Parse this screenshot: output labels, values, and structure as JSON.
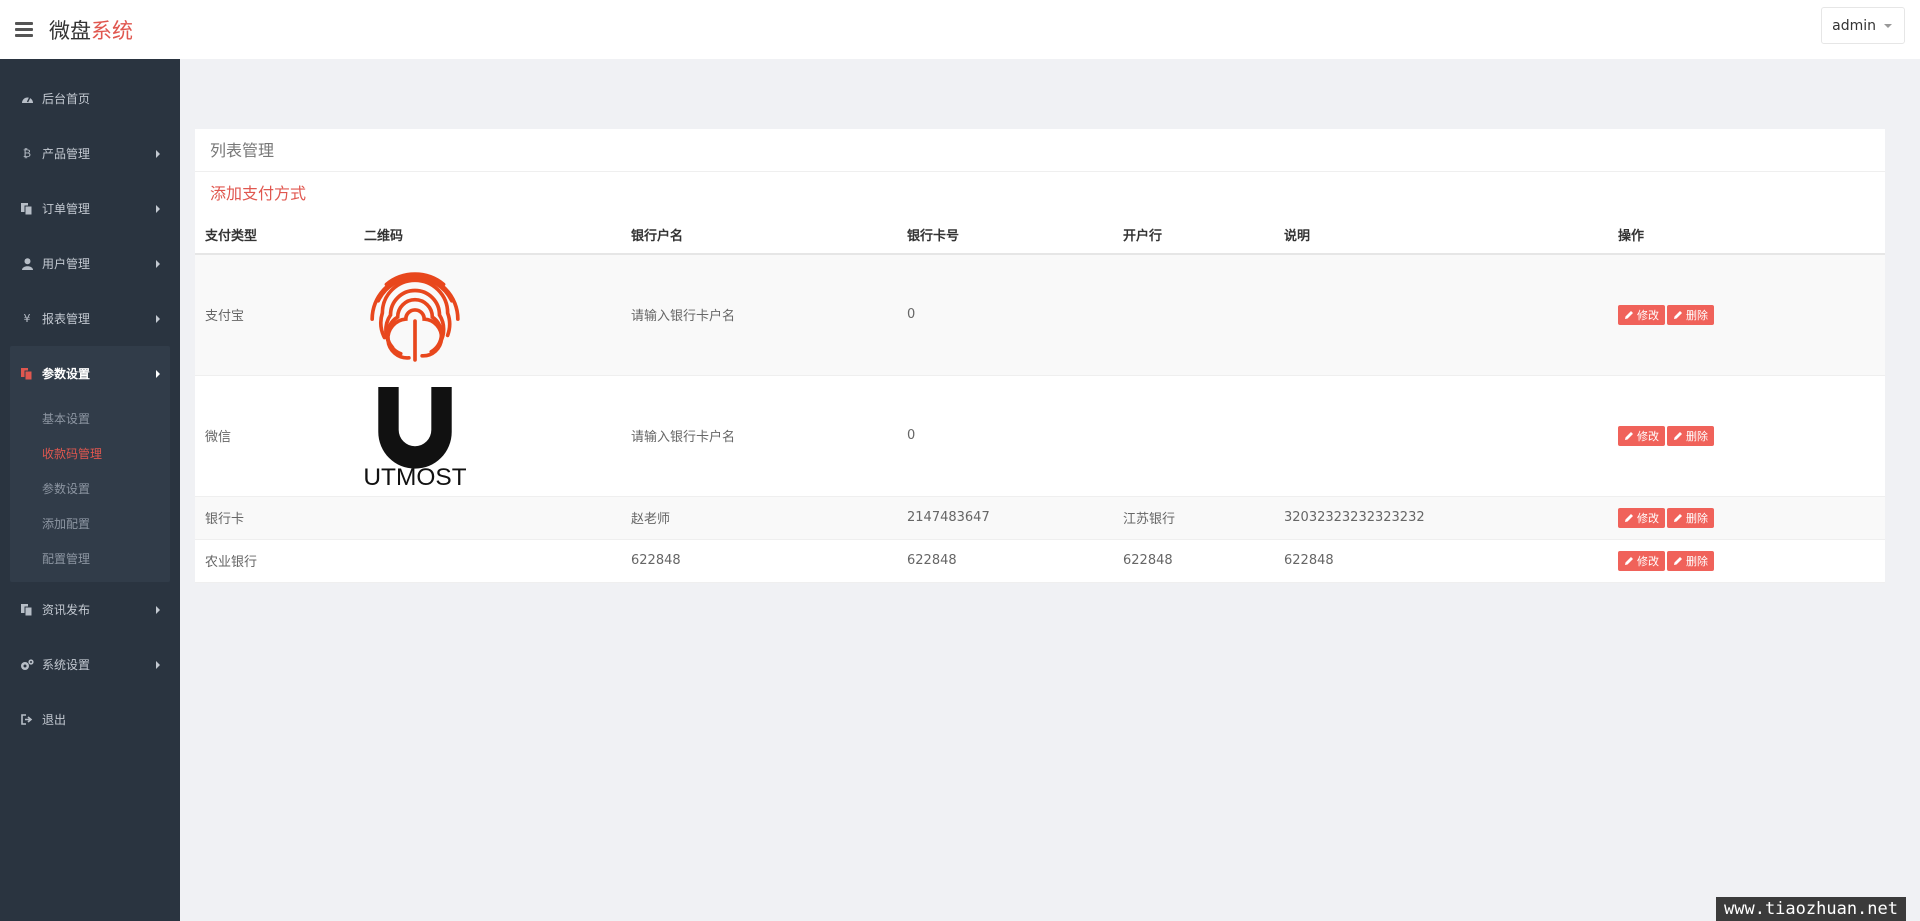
{
  "header": {
    "brand_prefix": "微盘",
    "brand_suffix": "系统",
    "user": "admin",
    "accent_color": "#e0574f"
  },
  "sidebar": {
    "items": [
      {
        "label": "后台首页",
        "icon": "dashboard-icon"
      },
      {
        "label": "产品管理",
        "icon": "bitcoin-icon"
      },
      {
        "label": "订单管理",
        "icon": "copy-icon"
      },
      {
        "label": "用户管理",
        "icon": "user-icon"
      },
      {
        "label": "报表管理",
        "icon": "yen-icon"
      },
      {
        "label": "参数设置",
        "icon": "copy-icon"
      },
      {
        "label": "资讯发布",
        "icon": "copy-icon"
      },
      {
        "label": "系统设置",
        "icon": "gears-icon"
      },
      {
        "label": "退出",
        "icon": "sign-out-icon"
      }
    ],
    "submenu": [
      "基本设置",
      "收款码管理",
      "参数设置",
      "添加配置",
      "配置管理"
    ]
  },
  "panel": {
    "title": "列表管理",
    "add_label": "添加支付方式"
  },
  "table": {
    "headers": [
      "支付类型",
      "二维码",
      "银行户名",
      "银行卡号",
      "开户行",
      "说明",
      "操作"
    ],
    "rows": [
      {
        "type": "支付宝",
        "qr": "fingerprint-logo",
        "name": "请输入银行卡户名",
        "card": "0",
        "bank": "",
        "note": ""
      },
      {
        "type": "微信",
        "qr": "utmost-logo",
        "name": "请输入银行卡户名",
        "card": "0",
        "bank": "",
        "note": ""
      },
      {
        "type": "银行卡",
        "qr": "",
        "name": "赵老师",
        "card": "2147483647",
        "bank": "江苏银行",
        "note": "32032323232323232"
      },
      {
        "type": "农业银行",
        "qr": "",
        "name": "622848",
        "card": "622848",
        "bank": "622848",
        "note": "622848"
      }
    ],
    "edit_label": "修改",
    "delete_label": "删除",
    "utmost_logo_text": "UTMOST"
  },
  "watermark": "www.tiaozhuan.net"
}
